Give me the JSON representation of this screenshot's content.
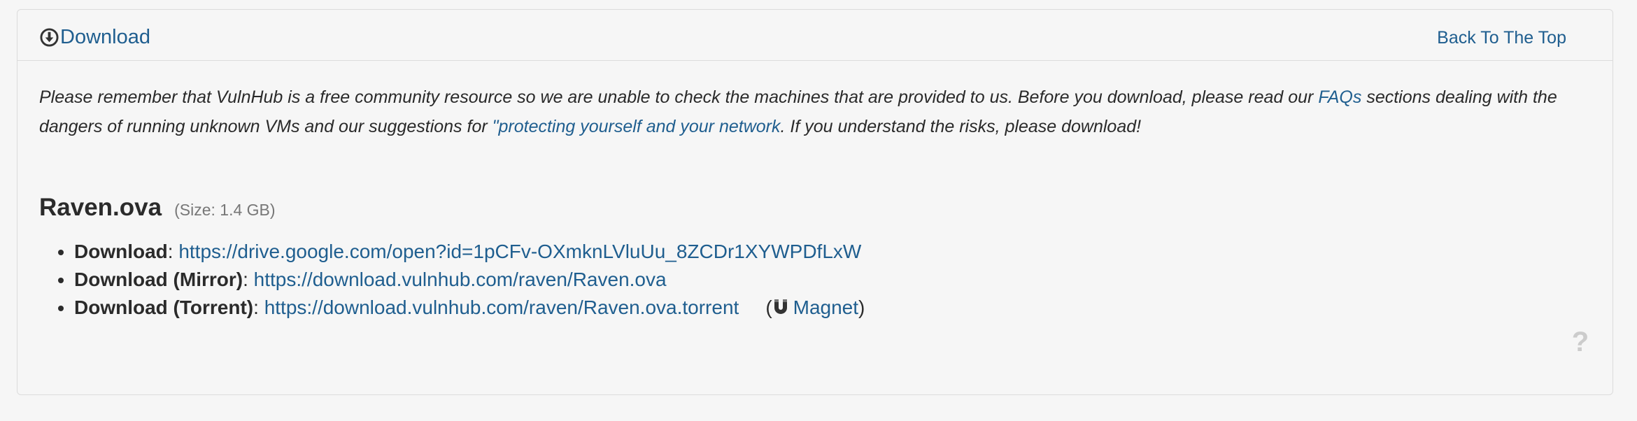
{
  "header": {
    "download_title": "Download",
    "back_to_top": "Back To The Top"
  },
  "notice": {
    "text_1": "Please remember that VulnHub is a free community resource so we are unable to check the machines that are provided to us. Before you download, please read our ",
    "faq_link": "FAQs",
    "text_2": " sections dealing with the dangers of running unknown VMs and our suggestions for ",
    "protect_link": "\"protecting yourself and your network",
    "text_3": ". If you understand the risks, please download!"
  },
  "file": {
    "name": "Raven.ova",
    "size": "(Size: 1.4 GB)"
  },
  "downloads": [
    {
      "label": "Download",
      "url": "https://drive.google.com/open?id=1pCFv-OXmknLVluUu_8ZCDr1XYWPDfLxW"
    },
    {
      "label": "Download (Mirror)",
      "url": "https://download.vulnhub.com/raven/Raven.ova"
    },
    {
      "label": "Download (Torrent)",
      "url": "https://download.vulnhub.com/raven/Raven.ova.torrent"
    }
  ],
  "magnet": {
    "label": "Magnet",
    "open_paren": "(",
    "close_paren": ")"
  },
  "separator": ": ",
  "help": {
    "glyph": "?"
  },
  "icons": {
    "download": "download-circle-icon",
    "magnet": "magnet-icon",
    "help": "question-icon"
  },
  "colors": {
    "link": "#1f5e8f",
    "background": "#f6f6f6",
    "border": "#dcdcdc"
  }
}
